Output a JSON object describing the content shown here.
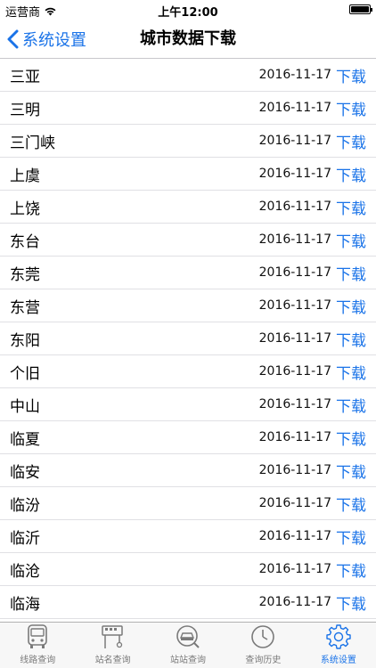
{
  "status_bar": {
    "carrier": "运营商",
    "time": "上午12:00",
    "battery_level": 1.0
  },
  "nav": {
    "back_label": "系统设置",
    "title": "城市数据下载"
  },
  "cities": [
    {
      "name": "三亚",
      "date": "2016-11-17",
      "action": "下载"
    },
    {
      "name": "三明",
      "date": "2016-11-17",
      "action": "下载"
    },
    {
      "name": "三门峡",
      "date": "2016-11-17",
      "action": "下载"
    },
    {
      "name": "上虞",
      "date": "2016-11-17",
      "action": "下载"
    },
    {
      "name": "上饶",
      "date": "2016-11-17",
      "action": "下载"
    },
    {
      "name": "东台",
      "date": "2016-11-17",
      "action": "下载"
    },
    {
      "name": "东莞",
      "date": "2016-11-17",
      "action": "下载"
    },
    {
      "name": "东营",
      "date": "2016-11-17",
      "action": "下载"
    },
    {
      "name": "东阳",
      "date": "2016-11-17",
      "action": "下载"
    },
    {
      "name": "个旧",
      "date": "2016-11-17",
      "action": "下载"
    },
    {
      "name": "中山",
      "date": "2016-11-17",
      "action": "下载"
    },
    {
      "name": "临夏",
      "date": "2016-11-17",
      "action": "下载"
    },
    {
      "name": "临安",
      "date": "2016-11-17",
      "action": "下载"
    },
    {
      "name": "临汾",
      "date": "2016-11-17",
      "action": "下载"
    },
    {
      "name": "临沂",
      "date": "2016-11-17",
      "action": "下载"
    },
    {
      "name": "临沧",
      "date": "2016-11-17",
      "action": "下载"
    },
    {
      "name": "临海",
      "date": "2016-11-17",
      "action": "下载"
    }
  ],
  "tabs": [
    {
      "label": "线路查询",
      "icon": "bus-icon"
    },
    {
      "label": "站名查询",
      "icon": "bus-stop-icon"
    },
    {
      "label": "站站查询",
      "icon": "car-search-icon"
    },
    {
      "label": "查询历史",
      "icon": "clock-icon"
    },
    {
      "label": "系统设置",
      "icon": "gear-icon",
      "active": true
    }
  ],
  "colors": {
    "accent": "#1a73e8",
    "inactive": "#7a7a7a"
  }
}
